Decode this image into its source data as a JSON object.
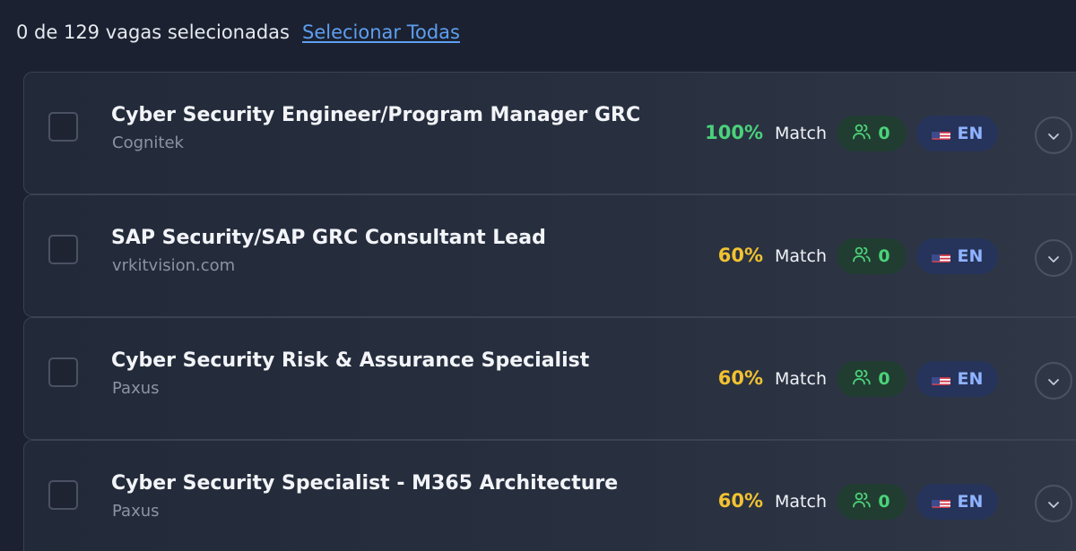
{
  "header": {
    "selection_count": "0 de 129 vagas selecionadas",
    "select_all": "Selecionar Todas"
  },
  "colors": {
    "match_high": "#4bd27a",
    "match_mid": "#f2c230",
    "link": "#5e9ff0"
  },
  "jobs": [
    {
      "title": "Cyber Security Engineer/Program Manager GRC",
      "company": "Cognitek",
      "match_pct": "100%",
      "match_level": "high",
      "match_label": "Match",
      "applicants": "0",
      "language": "EN",
      "flag_icon": "us-flag-icon"
    },
    {
      "title": "SAP Security/SAP GRC Consultant Lead",
      "company": "vrkitvision.com",
      "match_pct": "60%",
      "match_level": "mid",
      "match_label": "Match",
      "applicants": "0",
      "language": "EN",
      "flag_icon": "us-flag-icon"
    },
    {
      "title": "Cyber Security Risk & Assurance Specialist",
      "company": "Paxus",
      "match_pct": "60%",
      "match_level": "mid",
      "match_label": "Match",
      "applicants": "0",
      "language": "EN",
      "flag_icon": "us-flag-icon"
    },
    {
      "title": "Cyber Security Specialist - M365 Architecture",
      "company": "Paxus",
      "match_pct": "60%",
      "match_level": "mid",
      "match_label": "Match",
      "applicants": "0",
      "language": "EN",
      "flag_icon": "us-flag-icon"
    }
  ]
}
